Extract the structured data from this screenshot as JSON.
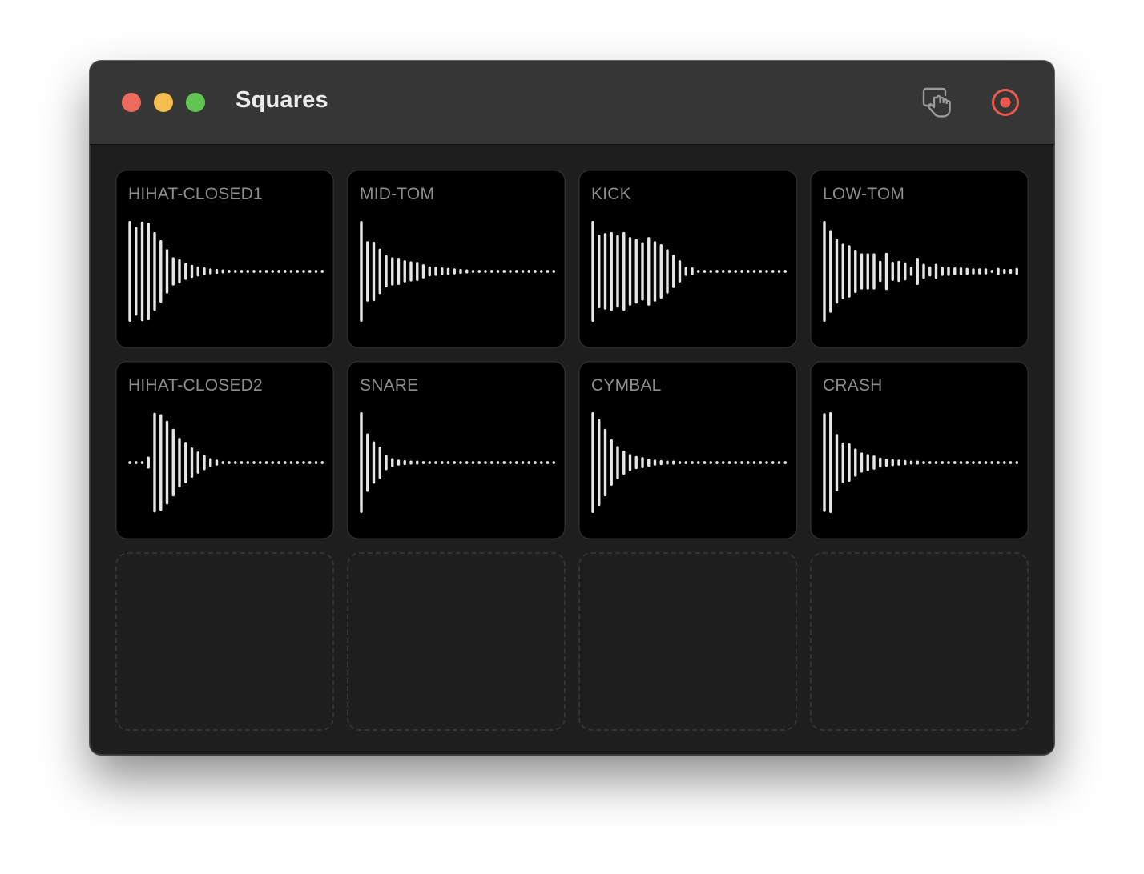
{
  "window": {
    "title": "Squares",
    "controls": [
      {
        "name": "close",
        "color": "#ec6a5e"
      },
      {
        "name": "minimize",
        "color": "#f4bf4f"
      },
      {
        "name": "zoom",
        "color": "#61c554"
      }
    ]
  },
  "toolbar": {
    "touch_button": {
      "icon": "hand-touch-icon",
      "color": "#9a9a9a"
    },
    "record_button": {
      "icon": "record-icon",
      "color": "#ec5a4b"
    }
  },
  "colors": {
    "waveform": "#e6e6e6",
    "label": "#8d8d8d",
    "pad_background": "#000000",
    "window_background": "#1e1e1e",
    "titlebar_background": "#363636"
  },
  "pads": [
    {
      "label": "HIHAT-CLOSED1",
      "amplitudes": [
        1.0,
        0.88,
        0.99,
        0.97,
        0.78,
        0.62,
        0.44,
        0.28,
        0.24,
        0.17,
        0.13,
        0.1,
        0.08,
        0.06,
        0.05,
        0.04,
        0.03,
        0.03,
        0.03,
        0.03,
        0.03,
        0.03,
        0.03,
        0.03,
        0.03,
        0.03,
        0.03,
        0.03,
        0.03,
        0.03,
        0.03,
        0.03
      ]
    },
    {
      "label": "MID-TOM",
      "amplitudes": [
        1.0,
        0.6,
        0.59,
        0.45,
        0.32,
        0.28,
        0.27,
        0.22,
        0.2,
        0.19,
        0.14,
        0.1,
        0.09,
        0.08,
        0.07,
        0.06,
        0.05,
        0.04,
        0.03,
        0.03,
        0.03,
        0.03,
        0.03,
        0.03,
        0.03,
        0.03,
        0.03,
        0.03,
        0.03,
        0.03,
        0.03,
        0.03
      ]
    },
    {
      "label": "KICK",
      "amplitudes": [
        1.0,
        0.73,
        0.76,
        0.78,
        0.72,
        0.78,
        0.68,
        0.64,
        0.58,
        0.68,
        0.6,
        0.54,
        0.44,
        0.33,
        0.22,
        0.09,
        0.08,
        0.03,
        0.03,
        0.03,
        0.03,
        0.03,
        0.03,
        0.03,
        0.03,
        0.03,
        0.03,
        0.03,
        0.03,
        0.03,
        0.03,
        0.03
      ]
    },
    {
      "label": "LOW-TOM",
      "amplitudes": [
        1.0,
        0.82,
        0.64,
        0.55,
        0.52,
        0.43,
        0.36,
        0.36,
        0.36,
        0.21,
        0.37,
        0.19,
        0.21,
        0.18,
        0.09,
        0.27,
        0.15,
        0.1,
        0.15,
        0.09,
        0.09,
        0.08,
        0.08,
        0.07,
        0.06,
        0.06,
        0.06,
        0.03,
        0.07,
        0.05,
        0.05,
        0.07
      ]
    },
    {
      "label": "HIHAT-CLOSED2",
      "amplitudes": [
        0.03,
        0.03,
        0.03,
        0.12,
        0.99,
        0.96,
        0.83,
        0.67,
        0.49,
        0.41,
        0.3,
        0.22,
        0.15,
        0.09,
        0.06,
        0.03,
        0.03,
        0.03,
        0.03,
        0.03,
        0.03,
        0.03,
        0.03,
        0.03,
        0.03,
        0.03,
        0.03,
        0.03,
        0.03,
        0.03,
        0.03,
        0.03
      ]
    },
    {
      "label": "SNARE",
      "amplitudes": [
        1.0,
        0.58,
        0.42,
        0.32,
        0.15,
        0.09,
        0.06,
        0.05,
        0.04,
        0.04,
        0.03,
        0.03,
        0.03,
        0.03,
        0.03,
        0.03,
        0.03,
        0.03,
        0.03,
        0.03,
        0.03,
        0.03,
        0.03,
        0.03,
        0.03,
        0.03,
        0.03,
        0.03,
        0.03,
        0.03,
        0.03,
        0.03
      ]
    },
    {
      "label": "CYMBAL",
      "amplitudes": [
        1.0,
        0.86,
        0.67,
        0.46,
        0.33,
        0.24,
        0.17,
        0.13,
        0.11,
        0.08,
        0.06,
        0.05,
        0.04,
        0.04,
        0.03,
        0.03,
        0.03,
        0.03,
        0.03,
        0.03,
        0.03,
        0.03,
        0.03,
        0.03,
        0.03,
        0.03,
        0.03,
        0.03,
        0.03,
        0.03,
        0.03,
        0.03
      ]
    },
    {
      "label": "CRASH",
      "amplitudes": [
        0.98,
        1.0,
        0.57,
        0.4,
        0.38,
        0.28,
        0.2,
        0.17,
        0.14,
        0.1,
        0.08,
        0.07,
        0.06,
        0.05,
        0.04,
        0.04,
        0.03,
        0.03,
        0.03,
        0.03,
        0.03,
        0.03,
        0.03,
        0.03,
        0.03,
        0.03,
        0.03,
        0.03,
        0.03,
        0.03,
        0.03,
        0.03
      ]
    }
  ],
  "empty_slots": 4
}
